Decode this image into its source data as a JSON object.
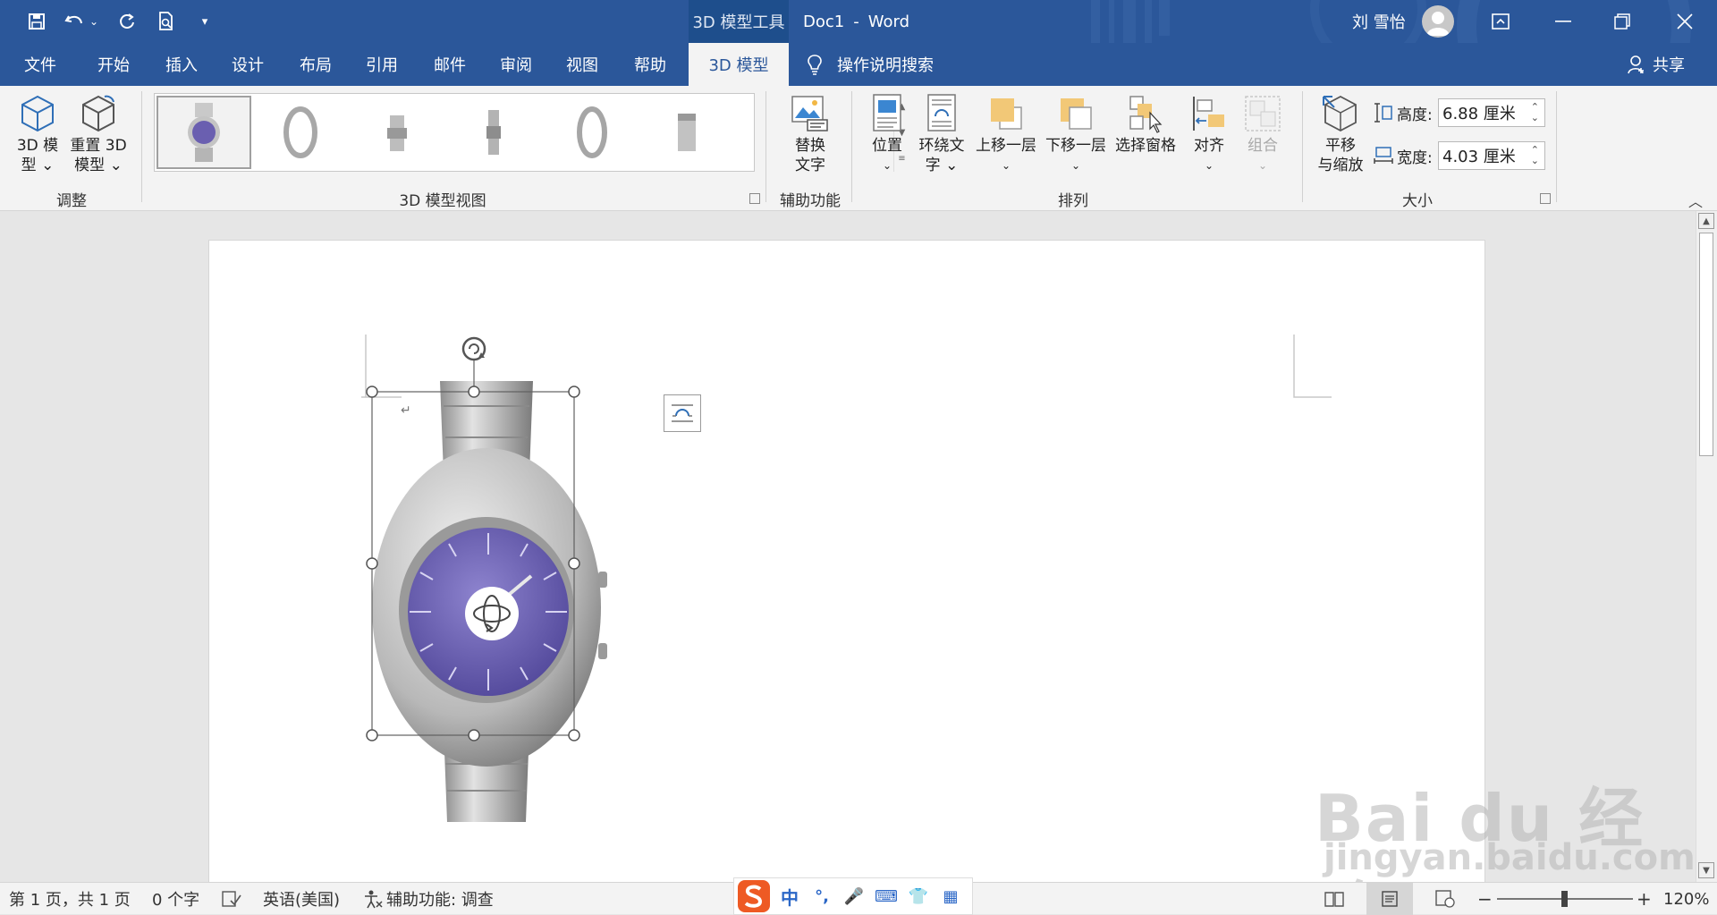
{
  "titlebar": {
    "context_tab": "3D 模型工具",
    "document": "Doc1",
    "separator": "-",
    "app": "Word",
    "user": "刘 雪怡"
  },
  "tabs": [
    "文件",
    "开始",
    "插入",
    "设计",
    "布局",
    "引用",
    "邮件",
    "审阅",
    "视图",
    "帮助",
    "3D 模型"
  ],
  "active_tab": "3D 模型",
  "tell_me": "操作说明搜索",
  "share": "共享",
  "ribbon": {
    "adjust": {
      "model_line1": "3D 模",
      "model_line2": "型 ⌄",
      "reset_line1": "重置 3D",
      "reset_line2": "模型 ⌄",
      "label": "调整"
    },
    "views": {
      "label": "3D 模型视图"
    },
    "accessibility": {
      "alt_line1": "替换",
      "alt_line2": "文字",
      "label": "辅助功能"
    },
    "arrange": {
      "position": "位置",
      "wrap_line1": "环绕文",
      "wrap_line2": "字 ⌄",
      "bring_forward": "上移一层",
      "send_backward": "下移一层",
      "selection_pane": "选择窗格",
      "align": "对齐",
      "group": "组合",
      "label": "排列"
    },
    "size": {
      "pan_line1": "平移",
      "pan_line2": "与缩放",
      "height_label": "高度:",
      "height_value": "6.88 厘米",
      "width_label": "宽度:",
      "width_value": "4.03 厘米",
      "label": "大小"
    }
  },
  "statusbar": {
    "page": "第 1 页，共 1 页",
    "words": "0 个字",
    "language": "英语(美国)",
    "accessibility": "辅助功能: 调查",
    "zoom": "120%",
    "ime": [
      "中",
      "°,",
      "🎤",
      "⌨",
      "👕",
      "▦"
    ]
  },
  "watermark": {
    "text": "Bai du 经验",
    "url": "jingyan.baidu.com"
  },
  "colors": {
    "accent": "#2b579a",
    "dial": "#6a5fb0"
  }
}
